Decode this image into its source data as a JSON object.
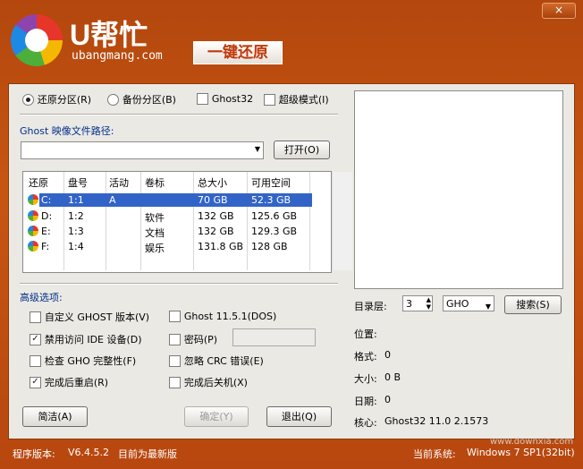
{
  "titlebar": {
    "close_label": "×"
  },
  "header": {
    "brand": "U帮忙",
    "domain": "ubangmang.com",
    "restore_badge": "一键还原"
  },
  "mode": {
    "restore": "还原分区(R)",
    "backup": "备份分区(B)",
    "ghost32": "Ghost32",
    "super": "超级模式(I)"
  },
  "image_path": {
    "label": "Ghost 映像文件路径:",
    "value": "",
    "open_button": "打开(O)"
  },
  "table": {
    "headers": [
      "还原",
      "盘号",
      "活动",
      "卷标",
      "总大小",
      "可用空间"
    ],
    "rows": [
      {
        "drive": "C:",
        "disk": "1:1",
        "active": "A",
        "label": "",
        "total": "70 GB",
        "free": "52.3 GB"
      },
      {
        "drive": "D:",
        "disk": "1:2",
        "active": "",
        "label": "软件",
        "total": "132 GB",
        "free": "125.6 GB"
      },
      {
        "drive": "E:",
        "disk": "1:3",
        "active": "",
        "label": "文档",
        "total": "132 GB",
        "free": "129.3 GB"
      },
      {
        "drive": "F:",
        "disk": "1:4",
        "active": "",
        "label": "娱乐",
        "total": "131.8 GB",
        "free": "128 GB"
      }
    ]
  },
  "advanced": {
    "title": "高级选项:",
    "custom_ghost": "自定义 GHOST 版本(V)",
    "ghost_version": "Ghost 11.5.1(DOS)",
    "disable_ide": "禁用访问 IDE 设备(D)",
    "password": "密码(P)",
    "password_value": "",
    "check_gho": "检查 GHO 完整性(F)",
    "ignore_crc": "忽略 CRC 错误(E)",
    "reboot_after": "完成后重启(R)",
    "shutdown_after": "完成后关机(X)"
  },
  "buttons": {
    "simple": "简洁(A)",
    "confirm": "确定(Y)",
    "exit": "退出(Q)",
    "search": "搜索(S)"
  },
  "directory": {
    "label": "目录层:",
    "level": "3",
    "filetype": "GHO"
  },
  "info": {
    "position_label": "位置:",
    "format_label": "格式:",
    "format_value": "0",
    "size_label": "大小:",
    "size_value": "0 B",
    "date_label": "日期:",
    "date_value": "0",
    "core_label": "核心:",
    "core_value": "Ghost32 11.0 2.1573"
  },
  "footer": {
    "version_label": "程序版本:",
    "version": "V6.4.5.2",
    "status": "目前为最新版",
    "system_label": "当前系统:",
    "system": "Windows 7 SP1(32bit)"
  },
  "watermark": {
    "site": "www.downxia.com"
  },
  "colors": {
    "title_bg": "#c75512",
    "panel_bg": "#ebe9e4",
    "selection": "#3264c8",
    "label_blue": "#00308a"
  }
}
